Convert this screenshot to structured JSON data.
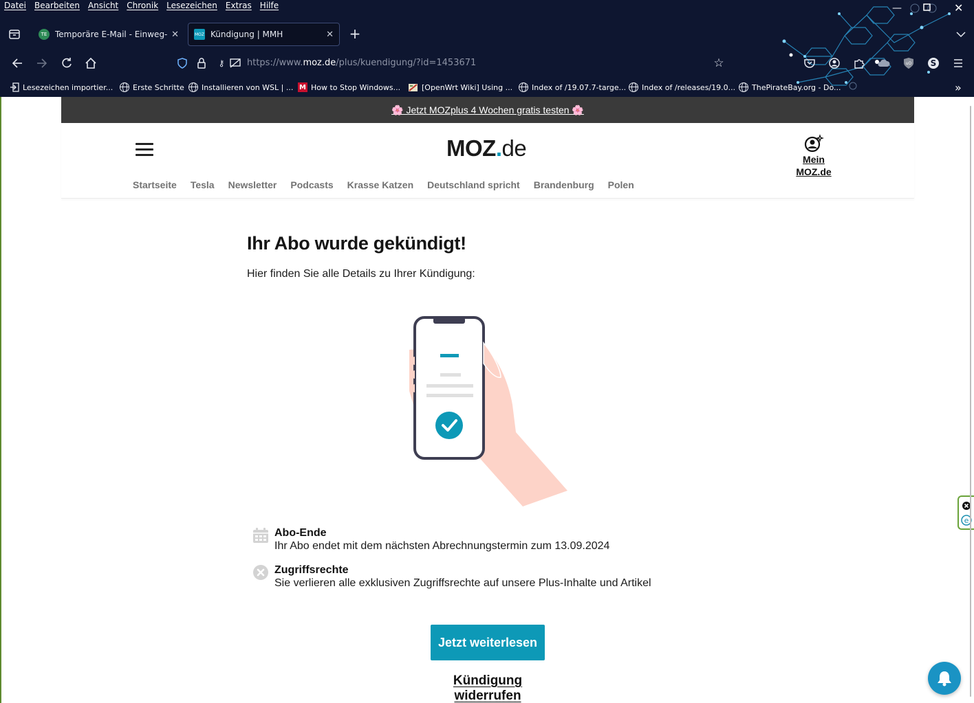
{
  "browser": {
    "menu": [
      "Datei",
      "Bearbeiten",
      "Ansicht",
      "Chronik",
      "Lesezeichen",
      "Extras",
      "Hilfe"
    ],
    "tabs": [
      {
        "title": "Temporäre E-Mail - Einweg-Mai",
        "favicon": "email-favicon",
        "active": false
      },
      {
        "title": "Kündigung | MMH",
        "favicon": "moz-favicon",
        "active": true
      }
    ],
    "url": {
      "prefix": "https://www.",
      "host": "moz.de",
      "path": "/plus/kuendigung/?id=1453671"
    },
    "bookmarks": [
      {
        "label": "Lesezeichen importier...",
        "icon": "import-icon"
      },
      {
        "label": "Erste Schritte",
        "icon": "globe-icon"
      },
      {
        "label": "Installieren von WSL | ...",
        "icon": "globe-icon"
      },
      {
        "label": "How to Stop Windows...",
        "icon": "m-favicon"
      },
      {
        "label": "[OpenWrt Wiki] Using ...",
        "icon": "openwrt-favicon"
      },
      {
        "label": "Index of /19.07.7-targe...",
        "icon": "globe-icon"
      },
      {
        "label": "Index of /releases/19.0...",
        "icon": "globe-icon"
      },
      {
        "label": "ThePirateBay.org - Do...",
        "icon": "globe-icon"
      }
    ]
  },
  "page": {
    "promo": "🌸 Jetzt MOZplus 4 Wochen gratis testen 🌸",
    "logo": {
      "moz": "MOZ",
      "dot": ".",
      "de": "de"
    },
    "account": "Mein MOZ.de",
    "nav": [
      "Startseite",
      "Tesla",
      "Newsletter",
      "Podcasts",
      "Krasse Katzen",
      "Deutschland spricht",
      "Brandenburg",
      "Polen"
    ],
    "headline": "Ihr Abo wurde gekündigt!",
    "subline": "Hier finden Sie alle Details zu Ihrer Kündigung:",
    "details": [
      {
        "title": "Abo-Ende",
        "text": "Ihr Abo endet mit dem nächsten Abrechnungstermin zum 13.09.2024",
        "icon": "calendar-icon"
      },
      {
        "title": "Zugriffsrechte",
        "text": "Sie verlieren alle exklusiven Zugriffsrechte auf unsere Plus-Inhalte und Artikel",
        "icon": "x-circle-icon"
      }
    ],
    "cta": "Jetzt weiterlesen",
    "revoke": "Kündigung widerrufen"
  },
  "colors": {
    "accent": "#0d99b7",
    "promo_bg": "#3a3a3a",
    "chrome_bg": "#0e1630",
    "bell_bg": "#1a93c4"
  }
}
